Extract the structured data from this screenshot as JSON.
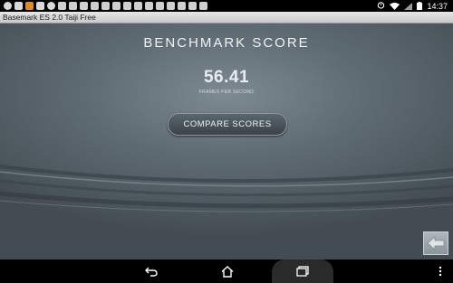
{
  "status_bar": {
    "time": "14:37"
  },
  "window": {
    "title": "Basemark ES 2.0 Taiji Free"
  },
  "result": {
    "heading": "BENCHMARK SCORE",
    "score": "56.41",
    "unit": "FRAMES PER SECOND",
    "compare_label": "COMPARE SCORES"
  },
  "icons": {
    "back_tile": "back-arrow-icon",
    "nav": [
      "back-icon",
      "home-icon",
      "recent-apps-icon",
      "overflow-menu-icon"
    ]
  },
  "colors": {
    "background": "#5f6b73",
    "button": "#3b4349"
  }
}
